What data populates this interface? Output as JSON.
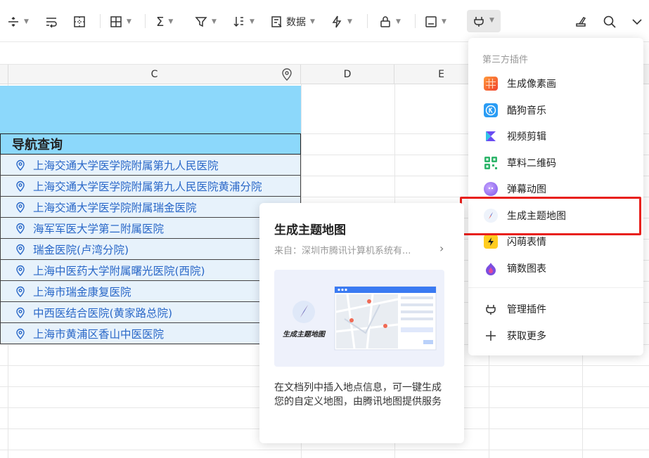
{
  "toolbar": {
    "data_label": "数据"
  },
  "sheet": {
    "columns": [
      "C",
      "D",
      "E"
    ],
    "nav_header": "导航查询",
    "locations": [
      "上海交通大学医学院附属第九人民医院",
      "上海交通大学医学院附属第九人民医院黄浦分院",
      "上海交通大学医学院附属瑞金医院",
      "海军军医大学第二附属医院",
      "瑞金医院(卢湾分院)",
      "上海中医药大学附属曙光医院(西院)",
      "上海市瑞金康复医院",
      "中西医结合医院(黄家路总院)",
      "上海市黄浦区香山中医医院"
    ]
  },
  "plugin_menu": {
    "group_label": "第三方插件",
    "items": [
      {
        "label": "生成像素画",
        "icon": "pixel-art-icon"
      },
      {
        "label": "酷狗音乐",
        "icon": "kugou-icon"
      },
      {
        "label": "视频剪辑",
        "icon": "video-edit-icon"
      },
      {
        "label": "草料二维码",
        "icon": "qrcode-icon"
      },
      {
        "label": "弹幕动图",
        "icon": "danmaku-icon"
      },
      {
        "label": "生成主题地图",
        "icon": "compass-icon"
      },
      {
        "label": "闪萌表情",
        "icon": "lightning-icon"
      },
      {
        "label": "镝数图表",
        "icon": "chart-icon"
      }
    ],
    "manage_label": "管理插件",
    "more_label": "获取更多"
  },
  "plugin_card": {
    "title": "生成主题地图",
    "source": "来自：深圳市腾讯计算机系统有...",
    "preview_caption": "生成主题地图",
    "description": "在文档列中插入地点信息，可一键生成您的自定义地图，由腾讯地图提供服务"
  },
  "colors": {
    "header_fill": "#8cd8fb",
    "link": "#2a68c8",
    "highlight": "#e8201c"
  }
}
